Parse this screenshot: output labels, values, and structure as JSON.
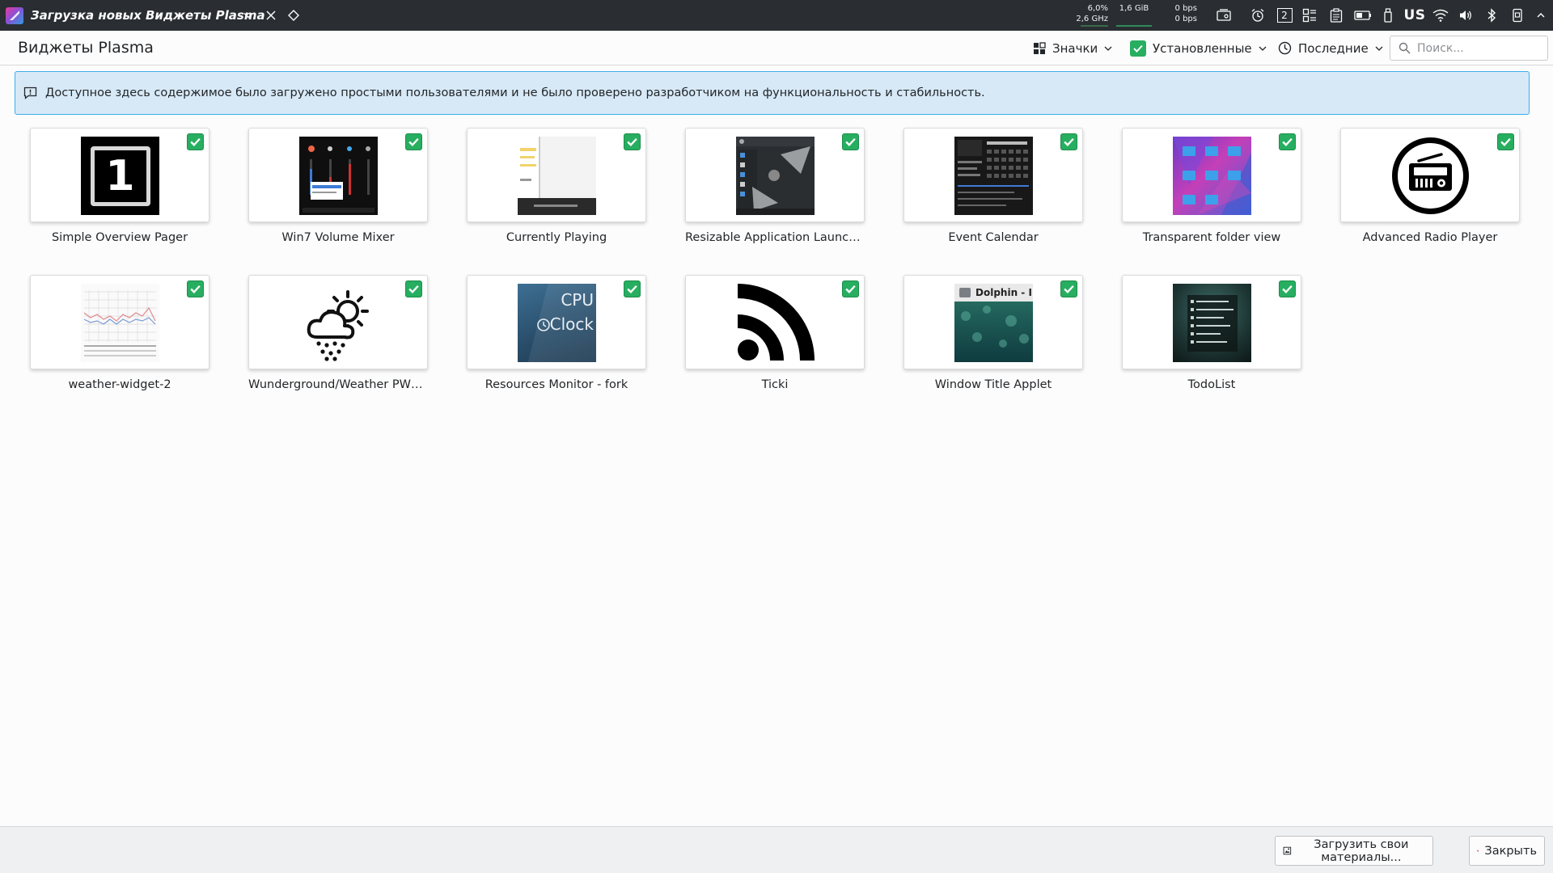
{
  "panel": {
    "window_title": "Загрузка новых Виджеты Plasma",
    "cpu_line1": "6,0%",
    "cpu_line2": "2,6 GHz",
    "memory": "1,6 GiB",
    "net_up": "0 bps",
    "net_down": "0 bps",
    "pager_number": "2",
    "keyboard_layout": "US"
  },
  "toolbar": {
    "title": "Виджеты Plasma",
    "view_label": "Значки",
    "filter_label": "Установленные",
    "sort_label": "Последние",
    "search_placeholder": "Поиск..."
  },
  "banner": {
    "text": "Доступное здесь содержимое было загружено простыми пользователями и не было проверено разработчиком на функциональность и стабильность."
  },
  "widgets": [
    {
      "name": "Simple Overview Pager",
      "installed": true
    },
    {
      "name": "Win7 Volume Mixer",
      "installed": true
    },
    {
      "name": "Currently Playing",
      "installed": true
    },
    {
      "name": "Resizable Application Launcher",
      "installed": true
    },
    {
      "name": "Event Calendar",
      "installed": true
    },
    {
      "name": "Transparent folder view",
      "installed": true
    },
    {
      "name": "Advanced Radio Player",
      "installed": true
    },
    {
      "name": "weather-widget-2",
      "installed": true
    },
    {
      "name": "Wunderground/Weather PWS ...",
      "installed": true
    },
    {
      "name": "Resources Monitor - fork",
      "installed": true
    },
    {
      "name": "Ticki",
      "installed": true
    },
    {
      "name": "Window Title Applet",
      "installed": true
    },
    {
      "name": "TodoList",
      "installed": true
    }
  ],
  "thumb_text": {
    "pager_digit": "1",
    "cpu_label": "CPU",
    "clock_label": "Clock",
    "dolphin_label": "Dolphin - I"
  },
  "footer": {
    "upload_label": "Загрузить свои материалы...",
    "close_label": "Закрыть"
  },
  "colors": {
    "accent": "#3daee9",
    "check": "#27ae60",
    "panel_bg": "#2a2e32",
    "banner_bg": "#d7e9f7",
    "close_icon": "#da4453"
  }
}
